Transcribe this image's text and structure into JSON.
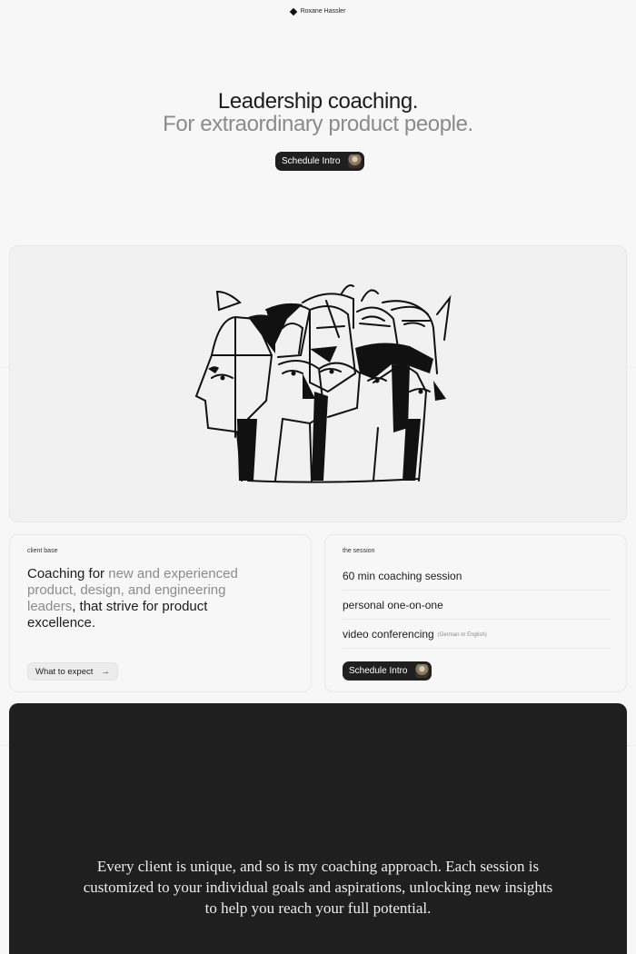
{
  "brand": {
    "name": "Roxane Hassler",
    "icon": "diamond-icon"
  },
  "hero": {
    "title": "Leadership coaching.",
    "subtitle": "For extraordinary product people.",
    "cta_label": "Schedule Intro"
  },
  "illustration": {
    "icon": "faces-illustration"
  },
  "client_card": {
    "label": "client base",
    "text_part1": "Coaching for",
    "text_part2": " new and experienced product, design, and engineering leaders",
    "text_part3": ", that strive for product excellence.",
    "button_label": "What to expect",
    "button_arrow": "→"
  },
  "session_card": {
    "label": "the session",
    "items": [
      {
        "text": "60 min coaching session",
        "note": ""
      },
      {
        "text": "personal one-on-one",
        "note": ""
      },
      {
        "text": "video conferencing",
        "note": "(German or English)"
      }
    ],
    "cta_label": "Schedule Intro"
  },
  "quote": {
    "text": "Every client is unique, and so is my coaching approach. Each session is customized to your individual goals and aspirations, unlocking new insights to help you reach your full potential."
  },
  "colors": {
    "background": "#f7f7f7",
    "dark": "#1f1f1f",
    "muted_text": "#8b8b8b"
  }
}
